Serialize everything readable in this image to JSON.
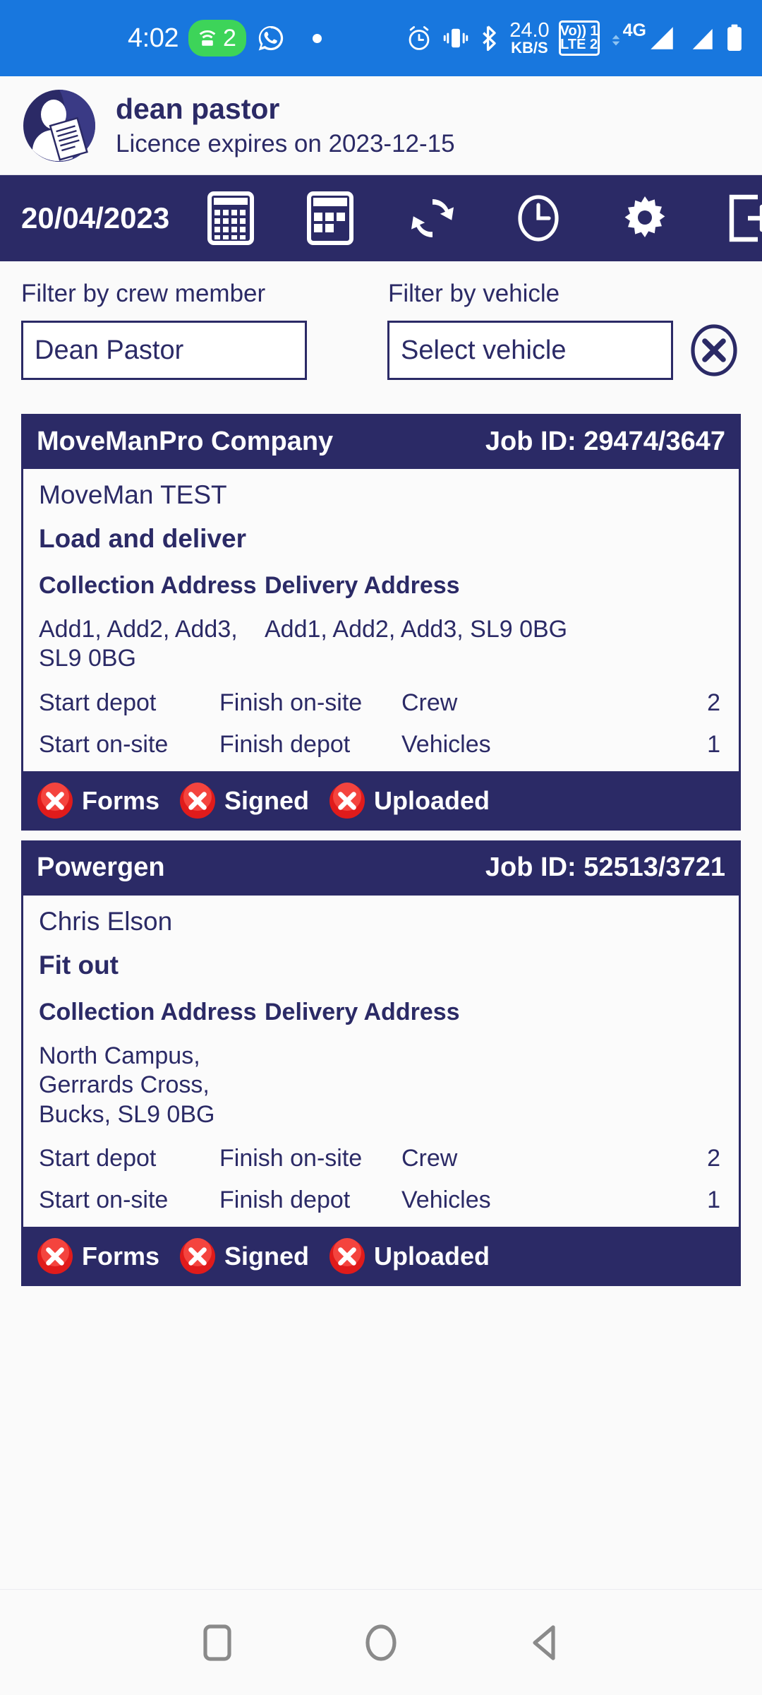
{
  "status_bar": {
    "time": "4:02",
    "hotspot_count": "2",
    "network_speed_value": "24.0",
    "network_speed_unit": "KB/S",
    "volte_line1": "Vo)) 1",
    "volte_line2": "LTE 2",
    "mobile_network": "4G",
    "icons": [
      "wifi-hotspot-icon",
      "whatsapp-icon",
      "dot-icon",
      "alarm-clock-icon",
      "vibrate-icon",
      "bluetooth-icon",
      "volte-icon",
      "signal-bars-icon",
      "battery-icon"
    ],
    "background_color": "#1877DE"
  },
  "user_header": {
    "name": "dean pastor",
    "licence": "Licence expires on 2023-12-15",
    "avatar_icon": "user-document-avatar"
  },
  "toolbar": {
    "date": "20/04/2023",
    "background_color": "#2B2A66",
    "buttons": [
      {
        "name": "month-calendar-icon",
        "label": "Month calendar"
      },
      {
        "name": "week-calendar-icon",
        "label": "Week calendar"
      },
      {
        "name": "sync-refresh-icon",
        "label": "Sync"
      },
      {
        "name": "clock-icon",
        "label": "Timesheet"
      },
      {
        "name": "gear-icon",
        "label": "Settings"
      },
      {
        "name": "logout-icon",
        "label": "Logout"
      }
    ]
  },
  "filters": {
    "crew_label": "Filter by crew member",
    "vehicle_label": "Filter by vehicle",
    "crew_value": "Dean Pastor",
    "vehicle_value": "Select vehicle",
    "clear_icon": "clear-filters-icon"
  },
  "labels": {
    "collection_address": "Collection Address",
    "delivery_address": "Delivery Address",
    "start_depot": "Start depot",
    "start_onsite": "Start on-site",
    "finish_onsite": "Finish on-site",
    "finish_depot": "Finish depot",
    "crew": "Crew",
    "vehicles": "Vehicles",
    "forms": "Forms",
    "signed": "Signed",
    "uploaded": "Uploaded"
  },
  "jobs": [
    {
      "company": "MoveManPro Company",
      "job_id": "Job ID: 29474/3647",
      "customer": "MoveMan TEST",
      "job_type": "Load and deliver",
      "collection_address": "Add1, Add2, Add3, SL9 0BG",
      "delivery_address": "Add1, Add2, Add3, SL9 0BG",
      "crew_count": "2",
      "vehicle_count": "1",
      "forms_status": "incomplete",
      "signed_status": "incomplete",
      "uploaded_status": "incomplete"
    },
    {
      "company": "Powergen",
      "job_id": "Job ID: 52513/3721",
      "customer": "Chris Elson",
      "job_type": "Fit out",
      "collection_address": "North Campus, Gerrards Cross, Bucks, SL9 0BG",
      "delivery_address": "",
      "crew_count": "2",
      "vehicle_count": "1",
      "forms_status": "incomplete",
      "signed_status": "incomplete",
      "uploaded_status": "incomplete"
    }
  ],
  "nav_bar": {
    "recents_icon": "recents-square-icon",
    "home_icon": "home-circle-icon",
    "back_icon": "back-triangle-icon"
  },
  "colors": {
    "status_bar_blue": "#1877DE",
    "brand_navy": "#2B2A66",
    "hotspot_green": "#3DD459",
    "error_red": "#E01B1B",
    "page_bg": "#FAFAFA"
  }
}
